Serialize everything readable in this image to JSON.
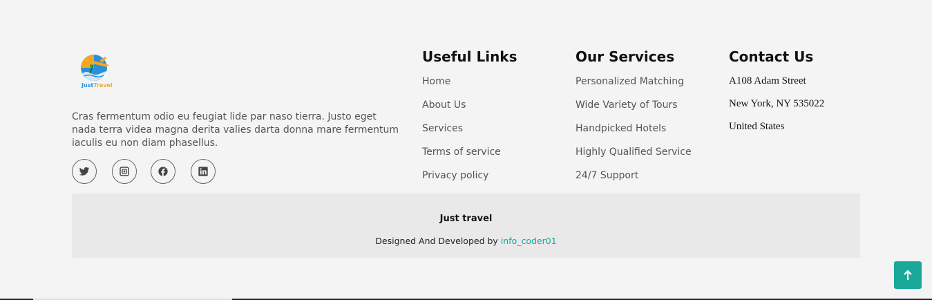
{
  "brand": {
    "logo_text_a": "Just",
    "logo_text_b": "Travel",
    "description": "Cras fermentum odio eu feugiat lide par naso tierra. Justo eget nada terra videa magna derita valies darta donna mare fermentum iaculis eu non diam phasellus."
  },
  "social": [
    "twitter",
    "instagram",
    "facebook",
    "linkedin"
  ],
  "useful_links": {
    "title": "Useful Links",
    "items": [
      "Home",
      "About Us",
      "Services",
      "Terms of service",
      "Privacy policy"
    ]
  },
  "services": {
    "title": "Our Services",
    "items": [
      "Personalized Matching",
      "Wide Variety of Tours",
      "Handpicked Hotels",
      "Highly Qualified Service",
      "24/7 Support"
    ]
  },
  "contact": {
    "title": "Contact Us",
    "lines": [
      "A108 Adam Street",
      "New York, NY 535022",
      "United States"
    ]
  },
  "footer_bar": {
    "brand": "Just travel",
    "credits_prefix": "Designed And Developed by",
    "credits_link": "info_coder01"
  },
  "colors": {
    "accent": "#1aa89a",
    "background": "#f4f4f4",
    "bar": "#e9e9e9"
  }
}
